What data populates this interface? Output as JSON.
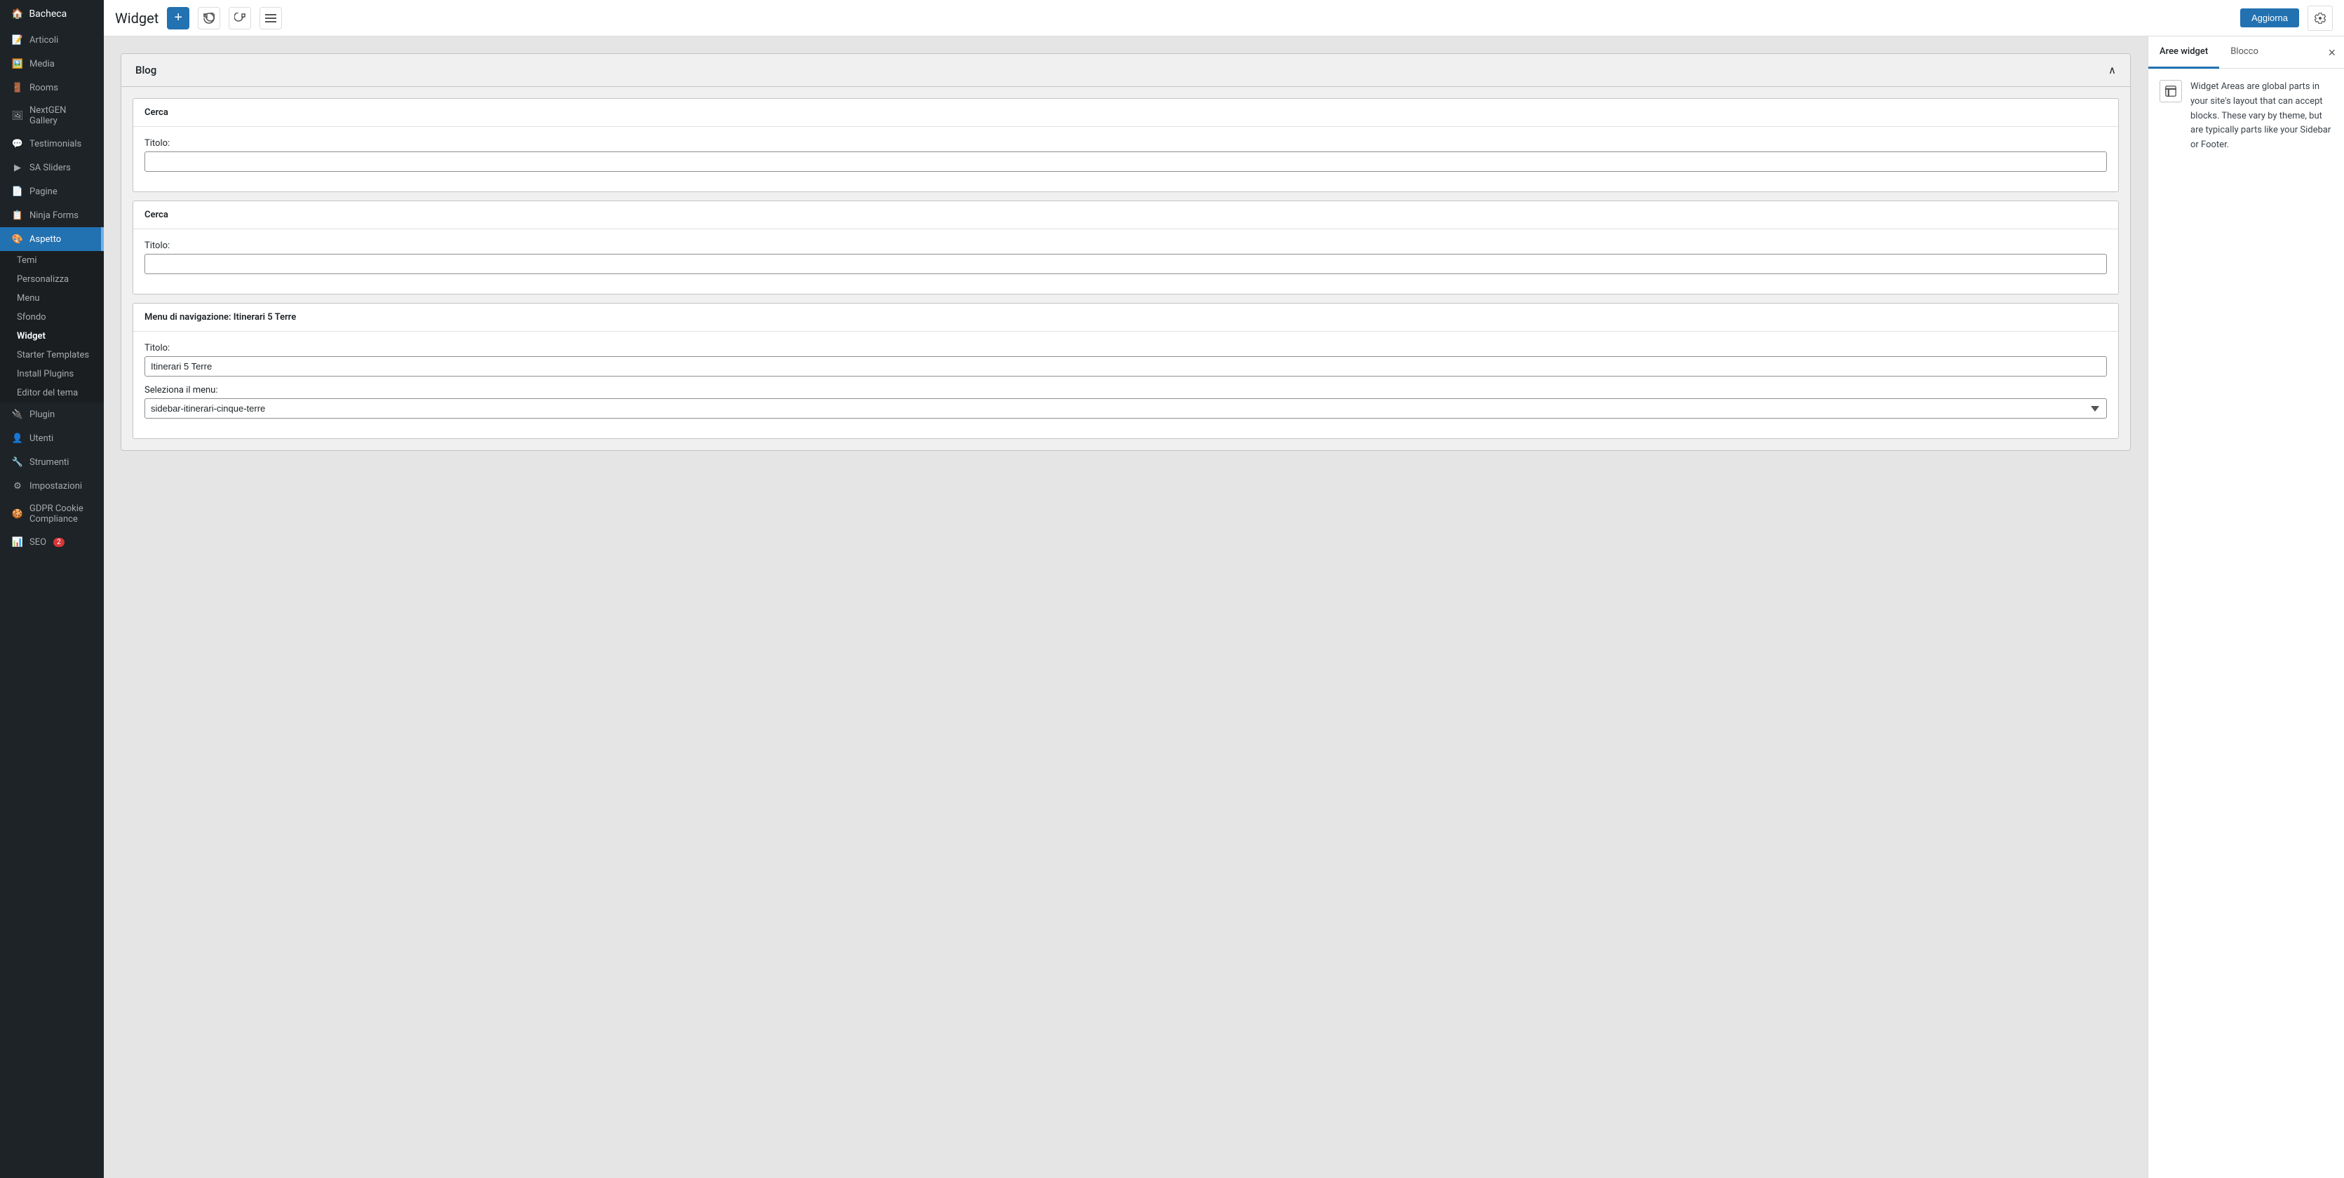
{
  "sidebar": {
    "brand": "Bacheca",
    "items": [
      {
        "id": "bacheca",
        "label": "Bacheca",
        "icon": "🏠"
      },
      {
        "id": "articoli",
        "label": "Articoli",
        "icon": "📝"
      },
      {
        "id": "media",
        "label": "Media",
        "icon": "🖼️"
      },
      {
        "id": "rooms",
        "label": "Rooms",
        "icon": "🚪"
      },
      {
        "id": "nextgen",
        "label": "NextGEN Gallery",
        "icon": "🖼"
      },
      {
        "id": "testimonials",
        "label": "Testimonials",
        "icon": "💬"
      },
      {
        "id": "sa-sliders",
        "label": "SA Sliders",
        "icon": "▶"
      },
      {
        "id": "pagine",
        "label": "Pagine",
        "icon": "📄"
      },
      {
        "id": "ninja-forms",
        "label": "Ninja Forms",
        "icon": "📋"
      },
      {
        "id": "aspetto",
        "label": "Aspetto",
        "icon": "🎨",
        "active": true
      },
      {
        "id": "plugin",
        "label": "Plugin",
        "icon": "🔌"
      },
      {
        "id": "utenti",
        "label": "Utenti",
        "icon": "👤"
      },
      {
        "id": "strumenti",
        "label": "Strumenti",
        "icon": "🔧"
      },
      {
        "id": "impostazioni",
        "label": "Impostazioni",
        "icon": "⚙"
      },
      {
        "id": "gdpr",
        "label": "GDPR Cookie Compliance",
        "icon": "🍪"
      },
      {
        "id": "seo",
        "label": "SEO",
        "icon": "📊",
        "badge": "2"
      }
    ],
    "submenu": [
      {
        "id": "temi",
        "label": "Temi"
      },
      {
        "id": "personalizza",
        "label": "Personalizza"
      },
      {
        "id": "menu",
        "label": "Menu"
      },
      {
        "id": "sfondo",
        "label": "Sfondo"
      },
      {
        "id": "widget",
        "label": "Widget",
        "active": true
      },
      {
        "id": "starter-templates",
        "label": "Starter Templates"
      },
      {
        "id": "install-plugins",
        "label": "Install Plugins"
      },
      {
        "id": "editor-del-tema",
        "label": "Editor del tema"
      }
    ]
  },
  "topbar": {
    "title": "Widget",
    "add_label": "+",
    "update_label": "Aggiorna"
  },
  "blog_section": {
    "title": "Blog",
    "widgets": [
      {
        "id": "cerca-1",
        "header": "Cerca",
        "fields": [
          {
            "id": "titolo-1",
            "label": "Titolo:",
            "type": "text",
            "value": "",
            "placeholder": ""
          }
        ]
      },
      {
        "id": "cerca-2",
        "header": "Cerca",
        "fields": [
          {
            "id": "titolo-2",
            "label": "Titolo:",
            "type": "text",
            "value": "",
            "placeholder": ""
          }
        ]
      },
      {
        "id": "nav-menu",
        "header": "Menu di navigazione: Itinerari 5 Terre",
        "fields": [
          {
            "id": "titolo-3",
            "label": "Titolo:",
            "type": "text",
            "value": "Itinerari 5 Terre",
            "placeholder": ""
          },
          {
            "id": "seleziona-menu",
            "label": "Seleziona il menu:",
            "type": "select",
            "value": "sidebar-itinerari-cinque-terre",
            "options": [
              "sidebar-itinerari-cinque-terre"
            ]
          }
        ]
      }
    ]
  },
  "right_panel": {
    "tabs": [
      {
        "id": "aree-widget",
        "label": "Aree widget",
        "active": true
      },
      {
        "id": "blocco",
        "label": "Blocco",
        "active": false
      }
    ],
    "close_label": "×",
    "info_text": "Widget Areas are global parts in your site's layout that can accept blocks. These vary by theme, but are typically parts like your Sidebar or Footer."
  }
}
